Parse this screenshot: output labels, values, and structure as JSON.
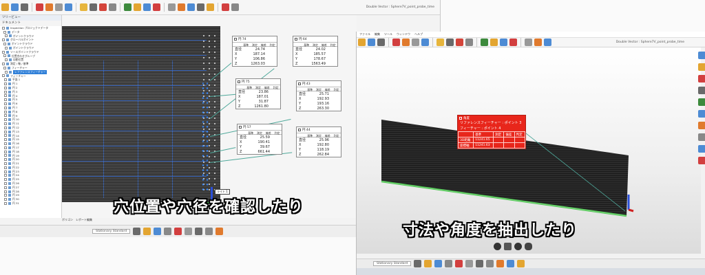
{
  "left_window": {
    "title_text": "Double Vector : Sphere7V_point_probe_time",
    "panel_title": "ツリービュー",
    "panel_subtitle": "ドキュメント",
    "tree_items": [
      {
        "label": "Inspection プロジェクトデータ",
        "icon": "folder-icon"
      },
      {
        "label": "データ",
        "icon": "folder-icon"
      },
      {
        "label": "ポイントクラウド",
        "icon": "cloud-icon"
      },
      {
        "label": "グローバルポイント",
        "icon": "cloud-icon"
      },
      {
        "label": "ポイントクラウド",
        "icon": "cloud-icon"
      },
      {
        "label": "ポイントクラウド",
        "icon": "cloud-icon"
      },
      {
        "label": "ソースポイントクラウド",
        "icon": "cloud-icon"
      },
      {
        "label": "位置合わせグループ",
        "icon": "folder-icon"
      },
      {
        "label": "自動位置",
        "icon": "feature-icon"
      },
      {
        "label": "測定 / 軸 / 基準",
        "icon": "feature-icon"
      },
      {
        "label": "フィーチャー",
        "icon": "folder-icon"
      },
      {
        "label": "レファレンスフィーチャー",
        "icon": "feature-icon",
        "selected": true
      },
      {
        "label": "フィーチャー",
        "icon": "folder-icon"
      },
      {
        "label": "平面 1",
        "icon": "plane-icon"
      },
      {
        "label": "円 1",
        "icon": "circle-icon"
      },
      {
        "label": "円 2",
        "icon": "circle-icon"
      },
      {
        "label": "円 3",
        "icon": "circle-icon"
      },
      {
        "label": "円 4",
        "icon": "circle-icon"
      },
      {
        "label": "円 5",
        "icon": "circle-icon"
      },
      {
        "label": "円 6",
        "icon": "circle-icon"
      },
      {
        "label": "円 7",
        "icon": "circle-icon"
      },
      {
        "label": "円 8",
        "icon": "circle-icon"
      },
      {
        "label": "円 9",
        "icon": "circle-icon"
      },
      {
        "label": "円 10",
        "icon": "circle-icon"
      },
      {
        "label": "円 11",
        "icon": "circle-icon"
      },
      {
        "label": "円 12",
        "icon": "circle-icon"
      },
      {
        "label": "円 13",
        "icon": "circle-icon"
      },
      {
        "label": "円 14",
        "icon": "circle-icon"
      },
      {
        "label": "円 15",
        "icon": "circle-icon"
      },
      {
        "label": "円 16",
        "icon": "circle-icon"
      },
      {
        "label": "円 17",
        "icon": "circle-icon"
      },
      {
        "label": "円 18",
        "icon": "circle-icon"
      },
      {
        "label": "円 19",
        "icon": "circle-icon"
      },
      {
        "label": "円 20",
        "icon": "circle-icon"
      },
      {
        "label": "円 21",
        "icon": "circle-icon"
      },
      {
        "label": "円 22",
        "icon": "circle-icon"
      },
      {
        "label": "円 23",
        "icon": "circle-icon"
      },
      {
        "label": "円 24",
        "icon": "circle-icon"
      },
      {
        "label": "円 25",
        "icon": "circle-icon"
      },
      {
        "label": "円 26",
        "icon": "circle-icon"
      },
      {
        "label": "円 27",
        "icon": "circle-icon"
      },
      {
        "label": "円 28",
        "icon": "circle-icon"
      },
      {
        "label": "円 29",
        "icon": "circle-icon"
      },
      {
        "label": "円 30",
        "icon": "circle-icon"
      },
      {
        "label": "円 31",
        "icon": "circle-icon"
      }
    ],
    "measure_cols": [
      "基準",
      "測定",
      "偏差",
      "判定"
    ],
    "measure_boxes": [
      {
        "title": "円 74",
        "rows": [
          {
            "k": "直径",
            "v": "24.74"
          },
          {
            "k": "X",
            "v": "187.14"
          },
          {
            "k": "Y",
            "v": "106.86"
          },
          {
            "k": "Z",
            "v": "1263.03"
          }
        ]
      },
      {
        "title": "円 64",
        "rows": [
          {
            "k": "直径",
            "v": "24.02"
          },
          {
            "k": "X",
            "v": "185.57"
          },
          {
            "k": "Y",
            "v": "178.67"
          },
          {
            "k": "Z",
            "v": "1563.49"
          }
        ]
      },
      {
        "title": "円 75",
        "rows": [
          {
            "k": "直径",
            "v": "23.86"
          },
          {
            "k": "X",
            "v": "187.01"
          },
          {
            "k": "Y",
            "v": "31.87"
          },
          {
            "k": "Z",
            "v": "1261.80"
          }
        ]
      },
      {
        "title": "円 43",
        "rows": [
          {
            "k": "直径",
            "v": "25.71"
          },
          {
            "k": "X",
            "v": "192.93"
          },
          {
            "k": "Y",
            "v": "193.16"
          },
          {
            "k": "Z",
            "v": "263.30"
          }
        ]
      },
      {
        "title": "円 57",
        "rows": [
          {
            "k": "直径",
            "v": "25.59"
          },
          {
            "k": "X",
            "v": "190.41"
          },
          {
            "k": "Y",
            "v": "39.67"
          },
          {
            "k": "Z",
            "v": "661.44"
          }
        ]
      },
      {
        "title": "円 44",
        "rows": [
          {
            "k": "直径",
            "v": "25.96"
          },
          {
            "k": "X",
            "v": "192.80"
          },
          {
            "k": "Y",
            "v": "118.19"
          },
          {
            "k": "Z",
            "v": "262.84"
          }
        ]
      }
    ],
    "point_label": "ライト 1",
    "bottom_tabs": [
      "ポリゴン",
      "レポート編集"
    ],
    "status_select": "Stationary Standard",
    "subtitle": "穴位置や穴径を確認したり"
  },
  "right_window": {
    "menus": [
      "ファイル",
      "編集",
      "ツール",
      "ウィンドウ",
      "ヘルプ"
    ],
    "title_text": "Double Vector : Sphere7V_point_probe_time",
    "callout_head": "角度",
    "callout_line1": "リファレンスフィーチャー : ポイント 3",
    "callout_line2": "フィーチャー : ポイント 4",
    "callout_cols": [
      "",
      "基準",
      "測定",
      "偏差",
      "判定"
    ],
    "callout_rows": [
      {
        "label": "3D距離",
        "value": "11241.65"
      },
      {
        "label": "座標軸",
        "value": "11241.63"
      }
    ],
    "status_select": "Stationary Standard",
    "subtitle": "寸法や角度を抽出したり"
  },
  "colors": {
    "accent_blue": "#2f7fd8",
    "callout_red": "#e8261b",
    "leader_teal": "#4ea89a"
  }
}
